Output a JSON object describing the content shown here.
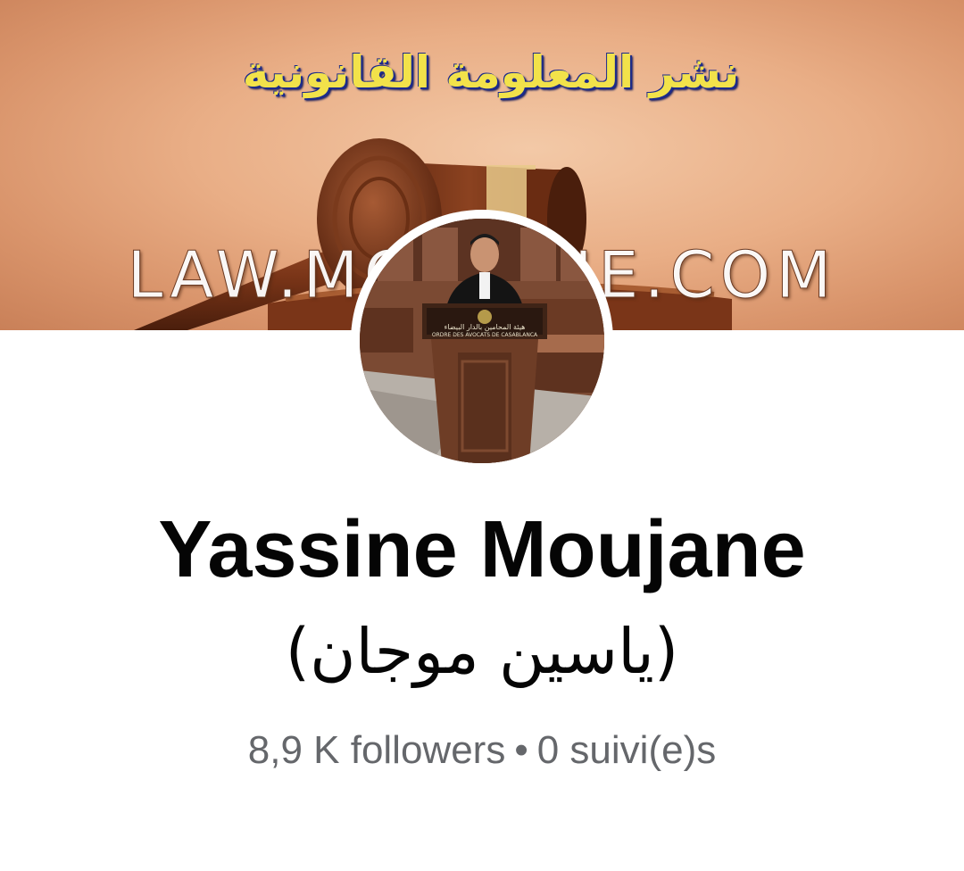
{
  "cover": {
    "title": "نشر المعلومة القانونية",
    "watermark": "LAW.MOUJANE.COM"
  },
  "avatar": {
    "podium_text_arabic": "هيئة المحامين بالدار البيضاء",
    "podium_text_latin": "ORDRE DES AVOCATS DE CASABLANCA"
  },
  "profile": {
    "name": "Yassine Moujane",
    "alternate_name": "(ياسين موجان)",
    "followers": "8,9 K followers",
    "separator": "•",
    "following": "0 suivi(e)s"
  },
  "colors": {
    "name_text": "#050505",
    "secondary_text": "#65676b",
    "cover_title_fill": "#f2e24a",
    "cover_title_outline": "#1b2a8c"
  }
}
